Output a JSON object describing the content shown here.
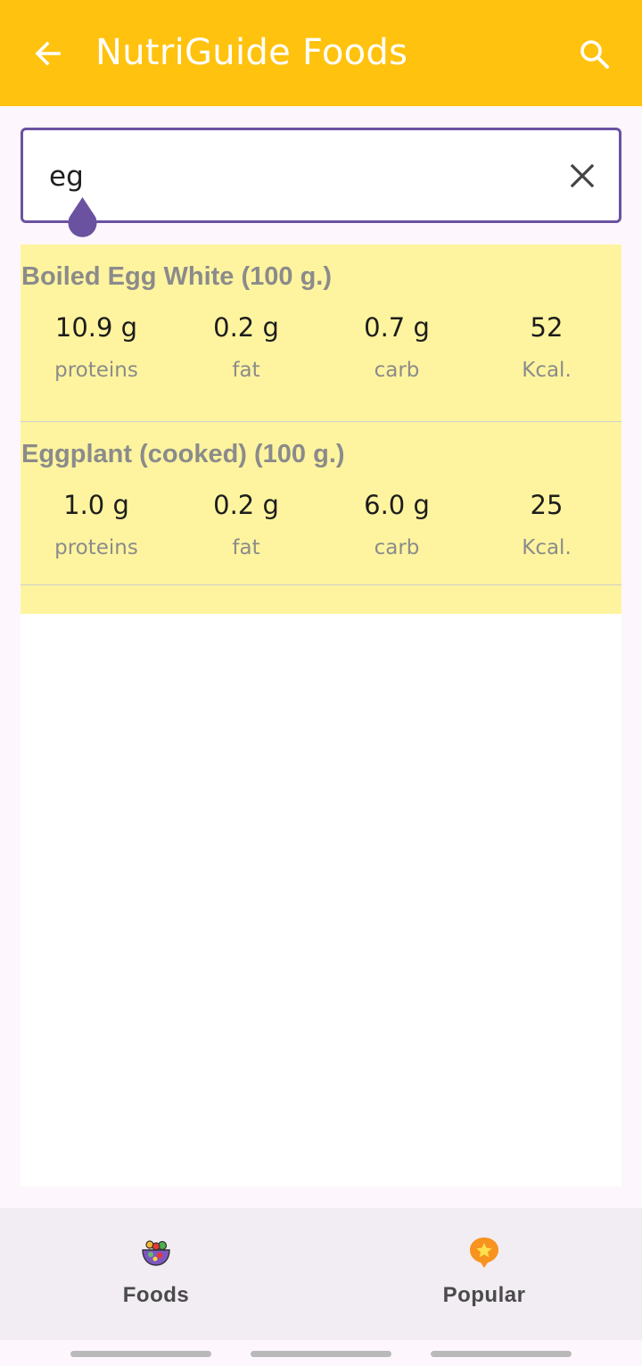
{
  "app_bar": {
    "title": "NutriGuide Foods"
  },
  "search": {
    "value": "eg"
  },
  "results": [
    {
      "name": "Boiled Egg White (100 g.)",
      "nutrients": [
        {
          "value": "10.9 g",
          "label": "proteins"
        },
        {
          "value": "0.2 g",
          "label": "fat"
        },
        {
          "value": "0.7 g",
          "label": "carb"
        },
        {
          "value": "52",
          "label": "Kcal."
        }
      ]
    },
    {
      "name": "Eggplant (cooked) (100 g.)",
      "nutrients": [
        {
          "value": "1.0 g",
          "label": "proteins"
        },
        {
          "value": "0.2 g",
          "label": "fat"
        },
        {
          "value": "6.0 g",
          "label": "carb"
        },
        {
          "value": "25",
          "label": "Kcal."
        }
      ]
    }
  ],
  "bottom_nav": {
    "items": [
      {
        "label": "Foods",
        "icon": "salad-bowl-icon"
      },
      {
        "label": "Popular",
        "icon": "star-badge-icon"
      }
    ]
  },
  "colors": {
    "app_bar": "#ffc20e",
    "accent": "#6a52a1",
    "card": "#fef49f"
  }
}
